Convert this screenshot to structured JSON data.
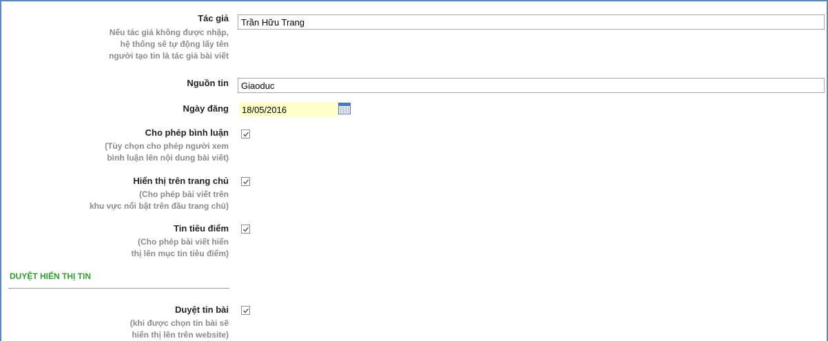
{
  "author": {
    "label": "Tác giả",
    "hint": [
      "Nếu tác giả không được nhập,",
      "hệ thống sẽ tự động lấy tên",
      "người tạo tin là tác giả bài viết"
    ],
    "value": "Trần Hữu Trang"
  },
  "source": {
    "label": "Nguồn tin",
    "value": "Giaoduc"
  },
  "publish_date": {
    "label": "Ngày đăng",
    "value": "18/05/2016",
    "icon": "calendar-icon"
  },
  "allow_comments": {
    "label": "Cho phép bình luận",
    "hint": [
      "(Tùy chọn cho phép người xem",
      "bình luận lên nội dung bài viết)"
    ],
    "checked": true
  },
  "show_on_home": {
    "label": "Hiển thị trên trang chủ",
    "hint": [
      "(Cho phép bài viết trên",
      "khu vực nổi bật trên đầu trang chủ)"
    ],
    "checked": true
  },
  "featured": {
    "label": "Tin tiêu điểm",
    "hint": [
      "(Cho phép bài viết hiển",
      "thị lên mục tin tiêu điểm)"
    ],
    "checked": true
  },
  "approval_section": {
    "title": "DUYỆT HIỂN THỊ TIN",
    "color": "#2e9c2e"
  },
  "approve": {
    "label": "Duyệt tin bài",
    "hint": [
      "(khi được chọn tin bài sẽ",
      "hiển thị lên trên website)"
    ],
    "checked": true
  }
}
